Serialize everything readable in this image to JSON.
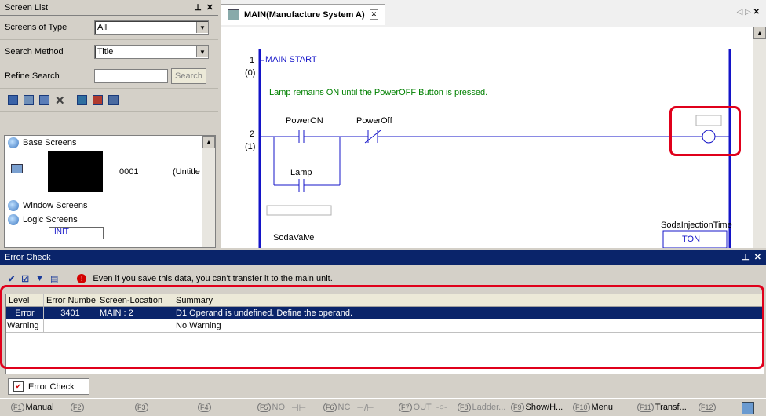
{
  "screen_list": {
    "title": "Screen List",
    "pin": "⊥",
    "close": "✕",
    "screens_of_type_label": "Screens of Type",
    "screens_of_type_value": "All",
    "search_method_label": "Search Method",
    "search_method_value": "Title",
    "refine_search_label": "Refine Search",
    "refine_search_value": "",
    "search_button": "Search",
    "tree": {
      "base_screens": "Base Screens",
      "screen_number": "0001",
      "screen_title": "(Untitle",
      "window_screens": "Window Screens",
      "logic_screens": "Logic Screens",
      "logic_thumb": "INIT"
    }
  },
  "editor": {
    "tab_title": "MAIN(Manufacture System A)",
    "rung1_number": "1",
    "rung1_step": "(0)",
    "rung1_label": "MAIN START",
    "comment": "Lamp remains ON until the PowerOFF Button is pressed.",
    "rung2_number": "2",
    "rung2_step": "(1)",
    "contact1": "PowerON",
    "contact2": "PowerOff",
    "contact3": "Lamp",
    "soda_valve": "SodaValve",
    "timer_name": "SodaInjectionTime",
    "timer_type": "TON"
  },
  "error_check": {
    "title": "Error Check",
    "pin": "⊥",
    "close": "✕",
    "warning_message": "Even if you save this data, you can't transfer it to the main unit.",
    "columns": [
      "Level",
      "Error Numbe",
      "Screen-Location",
      "Summary"
    ],
    "rows": [
      {
        "level": "Error",
        "number": "3401",
        "location": "MAIN : 2",
        "summary": "D1 Operand is undefined. Define the operand."
      },
      {
        "level": "Warning",
        "number": "",
        "location": "",
        "summary": "No Warning"
      }
    ],
    "bottom_tab": "Error Check"
  },
  "fkeys": {
    "f1": "F1",
    "f1_label": "Manual",
    "f2": "F2",
    "f3": "F3",
    "f4": "F4",
    "f5": "F5",
    "f5_label": "NO",
    "f6": "F6",
    "f6_label": "NC",
    "f7": "F7",
    "f7_label": "OUT",
    "f8": "F8",
    "f8_label": "Ladder...",
    "f9": "F9",
    "f9_label": "Show/H...",
    "f10": "F10",
    "f10_label": "Menu",
    "f11": "F11",
    "f11_label": "Transf...",
    "f12": "F12"
  },
  "colors": {
    "rail": "#1414c8",
    "highlight": "#e0001b",
    "selection": "#0a246a"
  }
}
